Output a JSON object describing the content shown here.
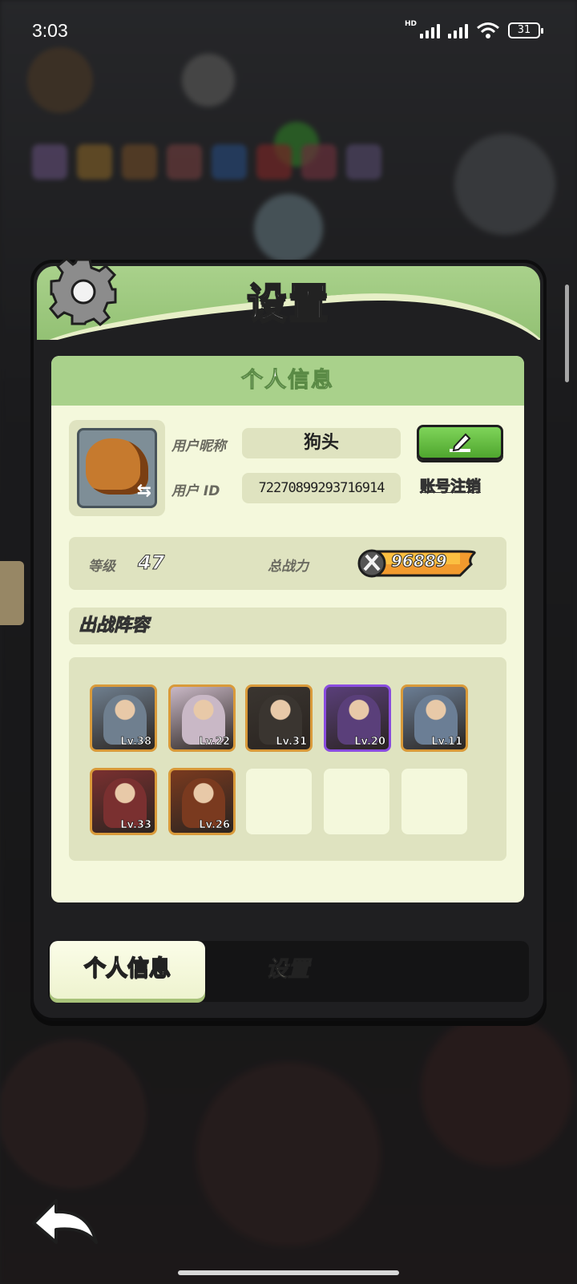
{
  "status_bar": {
    "time": "3:03",
    "network": "HD",
    "battery": "31"
  },
  "header": {
    "title": "设置"
  },
  "section": {
    "title": "个人信息"
  },
  "profile": {
    "nickname_label": "用户昵称",
    "nickname": "狗头",
    "id_label": "用户  ID",
    "user_id": "72270899293716914",
    "cancel_account": "账号注销"
  },
  "stats": {
    "level_label": "等级",
    "level": "47",
    "power_label": "总战力",
    "power": "96889"
  },
  "lineup": {
    "title": "出战阵容",
    "heroes": [
      {
        "level": "Lv.38",
        "rarity": "legendary",
        "color": "#6f7f8f"
      },
      {
        "level": "Lv.22",
        "rarity": "legendary",
        "color": "#c9b8c6"
      },
      {
        "level": "Lv.31",
        "rarity": "legendary",
        "color": "#3a3530"
      },
      {
        "level": "Lv.20",
        "rarity": "epic",
        "color": "#5a3f7a"
      },
      {
        "level": "Lv.11",
        "rarity": "legendary",
        "color": "#6b7e95"
      },
      {
        "level": "Lv.33",
        "rarity": "legendary",
        "color": "#7a3030"
      },
      {
        "level": "Lv.26",
        "rarity": "legendary",
        "color": "#7a3a1f"
      }
    ],
    "empty_slots": 3
  },
  "tabs": {
    "active": "个人信息",
    "other": "设置"
  },
  "icons": [
    "gear-icon",
    "edit-pencil-icon",
    "swap-icon",
    "sword-power-icon",
    "back-arrow-icon"
  ],
  "colors": {
    "accent_green": "#a9d18b",
    "card_bg": "#f4f8dc",
    "button_green": "#5fb83a",
    "power_orange": "#f29a2e"
  }
}
